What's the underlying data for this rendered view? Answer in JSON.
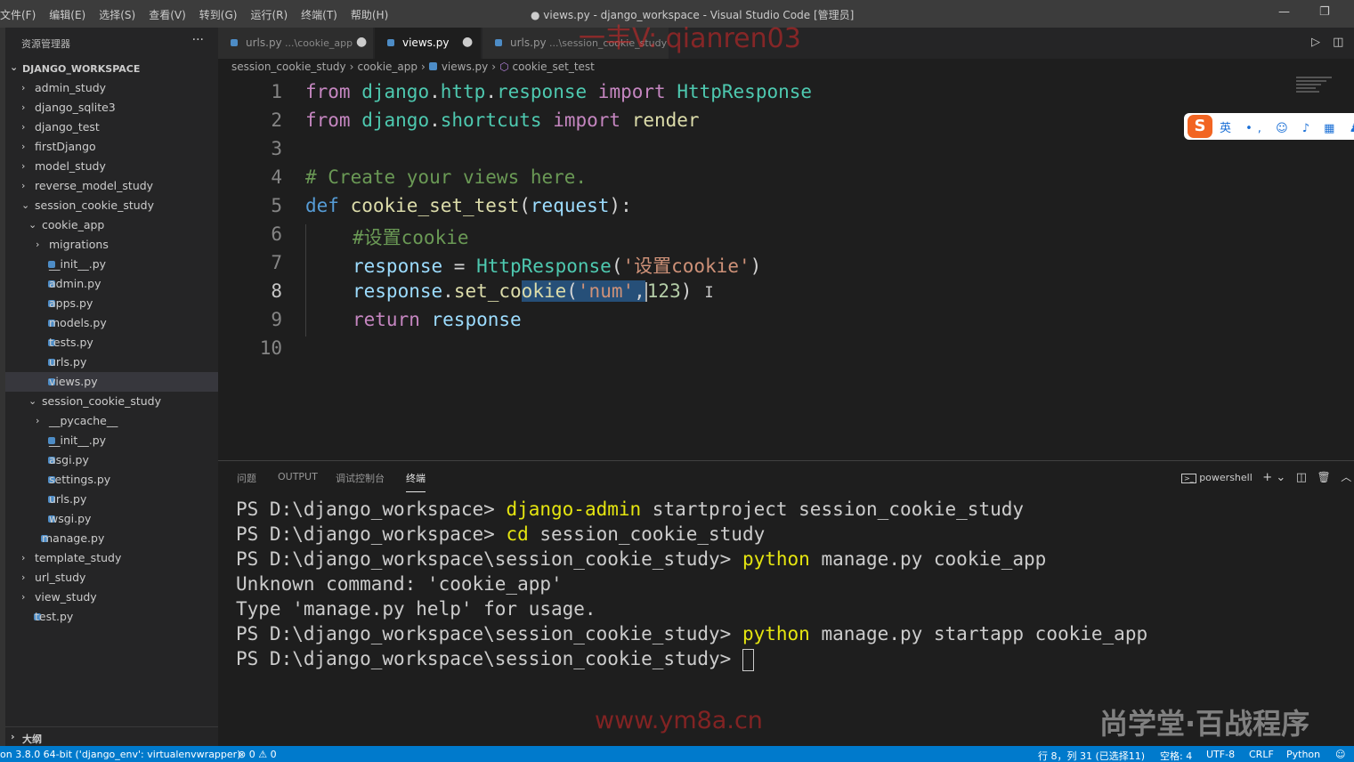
{
  "menu": [
    "文件(F)",
    "编辑(E)",
    "选择(S)",
    "查看(V)",
    "转到(G)",
    "运行(R)",
    "终端(T)",
    "帮助(H)"
  ],
  "window_title": "● views.py - django_workspace - Visual Studio Code [管理员]",
  "window_controls": {
    "minimize": "—",
    "maximize": "❐"
  },
  "explorer": {
    "header": "资源管理器",
    "more": "···",
    "workspace": "DJANGO_WORKSPACE",
    "chevron_right": "›",
    "chevron_down": "⌄",
    "items": [
      {
        "label": "admin_study"
      },
      {
        "label": "django_sqlite3"
      },
      {
        "label": "django_test"
      },
      {
        "label": "firstDjango"
      },
      {
        "label": "model_study"
      },
      {
        "label": "reverse_model_study"
      },
      {
        "label": "session_cookie_study"
      },
      {
        "label": "cookie_app"
      },
      {
        "label": "migrations"
      },
      {
        "label": "__init__.py"
      },
      {
        "label": "admin.py"
      },
      {
        "label": "apps.py"
      },
      {
        "label": "models.py"
      },
      {
        "label": "tests.py"
      },
      {
        "label": "urls.py"
      },
      {
        "label": "views.py"
      },
      {
        "label": "session_cookie_study"
      },
      {
        "label": "__pycache__"
      },
      {
        "label": "__init__.py"
      },
      {
        "label": "asgi.py"
      },
      {
        "label": "settings.py"
      },
      {
        "label": "urls.py"
      },
      {
        "label": "wsgi.py"
      },
      {
        "label": "manage.py"
      },
      {
        "label": "template_study"
      },
      {
        "label": "url_study"
      },
      {
        "label": "view_study"
      },
      {
        "label": "test.py"
      }
    ],
    "outline": "大纲"
  },
  "tabs": [
    {
      "name": "urls.py",
      "path": "...\\cookie_app",
      "dot": "●"
    },
    {
      "name": "views.py",
      "path": "",
      "dot": "●"
    },
    {
      "name": "urls.py",
      "path": "...\\session_cookie_study",
      "dot": ""
    }
  ],
  "editor_actions": {
    "run": "▷",
    "split": "◫"
  },
  "breadcrumbs": [
    "session_cookie_study",
    "cookie_app",
    "views.py",
    "cookie_set_test"
  ],
  "breadcrumb_sep": "›",
  "code": {
    "line_numbers": [
      "1",
      "2",
      "3",
      "4",
      "5",
      "6",
      "7",
      "8",
      "9",
      "10"
    ],
    "l1": {
      "kw1": "from",
      "mod1": "django",
      "dot1": ".",
      "mod2": "http",
      "dot2": ".",
      "mod3": "response",
      "kw2": "import",
      "cls": "HttpResponse"
    },
    "l2": {
      "kw1": "from",
      "mod1": "django",
      "dot1": ".",
      "mod2": "shortcuts",
      "kw2": "import",
      "fn": "render"
    },
    "l4": {
      "comment": "# Create your views here."
    },
    "l5": {
      "kw": "def",
      "fn": "cookie_set_test",
      "p1": "(",
      "param": "request",
      "p2": "):"
    },
    "l6": {
      "comment": "#设置cookie"
    },
    "l7": {
      "var": "response",
      "eq": " = ",
      "cls": "HttpResponse",
      "p1": "(",
      "str": "'设置cookie'",
      "p2": ")"
    },
    "l8": {
      "var": "response",
      "dot": ".",
      "fn1": "set_co",
      "fn2": "okie",
      "p1": "(",
      "str": "'num'",
      "comma": ",",
      "num": "123",
      "p2": ")"
    },
    "l9": {
      "kw": "return",
      "var": "response"
    }
  },
  "ime": {
    "logo": "S",
    "text": "英 •, ☺ ♪ ▦ ♟ ⇡"
  },
  "panel": {
    "tabs": [
      "问题",
      "OUTPUT",
      "调试控制台",
      "终端"
    ],
    "actions": {
      "shell": "powershell",
      "add": "+ ⌄",
      "split": "◫",
      "trash": "🗑",
      "up": "︿"
    }
  },
  "terminal": {
    "lines": [
      {
        "prompt": "PS D:\\django_workspace> ",
        "cmd": "django-admin",
        "rest": " startproject session_cookie_study"
      },
      {
        "prompt": "PS D:\\django_workspace> ",
        "cmd": "cd",
        "rest": " session_cookie_study"
      },
      {
        "prompt": "PS D:\\django_workspace\\session_cookie_study> ",
        "cmd": "python",
        "rest": " manage.py cookie_app"
      },
      {
        "prompt": "Unknown command: 'cookie_app'",
        "cmd": "",
        "rest": ""
      },
      {
        "prompt": "Type 'manage.py help' for usage.",
        "cmd": "",
        "rest": ""
      },
      {
        "prompt": "PS D:\\django_workspace\\session_cookie_study> ",
        "cmd": "python",
        "rest": " manage.py startapp cookie_app"
      },
      {
        "prompt": "PS D:\\django_workspace\\session_cookie_study> ",
        "cmd": "",
        "rest": ""
      }
    ]
  },
  "statusbar": {
    "interpreter": "on 3.8.0 64-bit ('django_env': virtualenvwrapper)",
    "problems": "⊗ 0 ⚠ 0",
    "position": "行 8，列 31 (已选择11)",
    "spaces": "空格: 4",
    "encoding": "UTF-8",
    "eol": "CRLF",
    "language": "Python",
    "feedback": "☺"
  },
  "watermarks": {
    "top": "一丰V: qianren03",
    "bottom": "www.ym8a.cn",
    "logo": "尚学堂·百战程序"
  }
}
